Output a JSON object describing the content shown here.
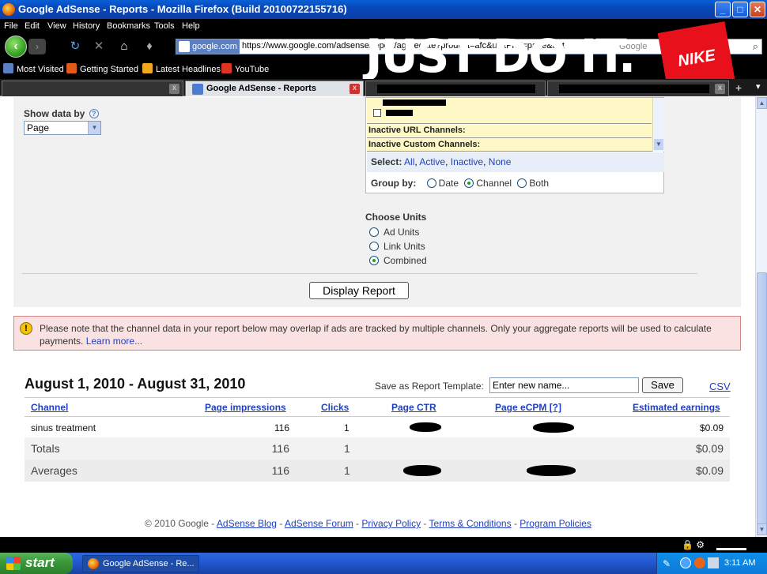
{
  "window": {
    "title": "Google AdSense - Reports - Mozilla Firefox (Build 20100722155716)",
    "min": "_",
    "max": "□",
    "close": "✕"
  },
  "menu": [
    "File",
    "Edit",
    "View",
    "History",
    "Bookmarks",
    "Tools",
    "Help"
  ],
  "nav": {
    "site_label": "google.com",
    "url": "https://www.google.com/adsense/report/aggregate?product=afc&unitPref=page&dat",
    "search_placeholder": "Google"
  },
  "bookmarks": [
    "Most Visited",
    "Getting Started",
    "Latest Headlines",
    "YouTube"
  ],
  "overlay": {
    "slogan": "JUST DO IT.",
    "brand": "NIKE"
  },
  "tabs": {
    "active": "Google AdSense - Reports",
    "close": "x",
    "new_tab": "+",
    "list": "▾"
  },
  "filters": {
    "show_data_by_label": "Show data by",
    "help": "?",
    "show_data_by_value": "Page",
    "channel_list": [
      "Inactive URL Channels:",
      "Inactive Custom Channels:"
    ],
    "select_label": "Select:",
    "select_links": [
      "All",
      "Active",
      "Inactive",
      "None"
    ],
    "group_by_label": "Group by:",
    "group_by_options": [
      "Date",
      "Channel",
      "Both"
    ],
    "group_by_selected": "Channel",
    "units_label": "Choose Units",
    "units_options": [
      "Ad Units",
      "Link Units",
      "Combined"
    ],
    "units_selected": "Combined",
    "display_button": "Display Report"
  },
  "notice": {
    "text": "Please note that the channel data in your report below may overlap if ads are tracked by multiple channels. Only your aggregate reports will be used to calculate payments.",
    "link": "Learn more..."
  },
  "report": {
    "date_range": "August 1, 2010 - August 31, 2010",
    "save_template_label": "Save as Report Template:",
    "template_input_value": "Enter new name...",
    "save_button": "Save",
    "csv_link": "CSV",
    "columns": [
      "Channel",
      "Page impressions",
      "Clicks",
      "Page CTR",
      "Page eCPM [?]",
      "Estimated earnings"
    ],
    "rows": [
      {
        "channel": "sinus treatment",
        "impressions": "116",
        "clicks": "1",
        "earnings": "$0.09"
      }
    ],
    "totals": {
      "label": "Totals",
      "impressions": "116",
      "clicks": "1",
      "earnings": "$0.09"
    },
    "averages": {
      "label": "Averages",
      "impressions": "116",
      "clicks": "1",
      "earnings": "$0.09"
    }
  },
  "footer": {
    "copyright": "© 2010 Google -",
    "links": [
      "AdSense Blog",
      "AdSense Forum",
      "Privacy Policy",
      "Terms & Conditions",
      "Program Policies"
    ],
    "sep": "-"
  },
  "taskbar": {
    "start": "start",
    "task": "Google AdSense - Re...",
    "clock": "3:11 AM"
  }
}
